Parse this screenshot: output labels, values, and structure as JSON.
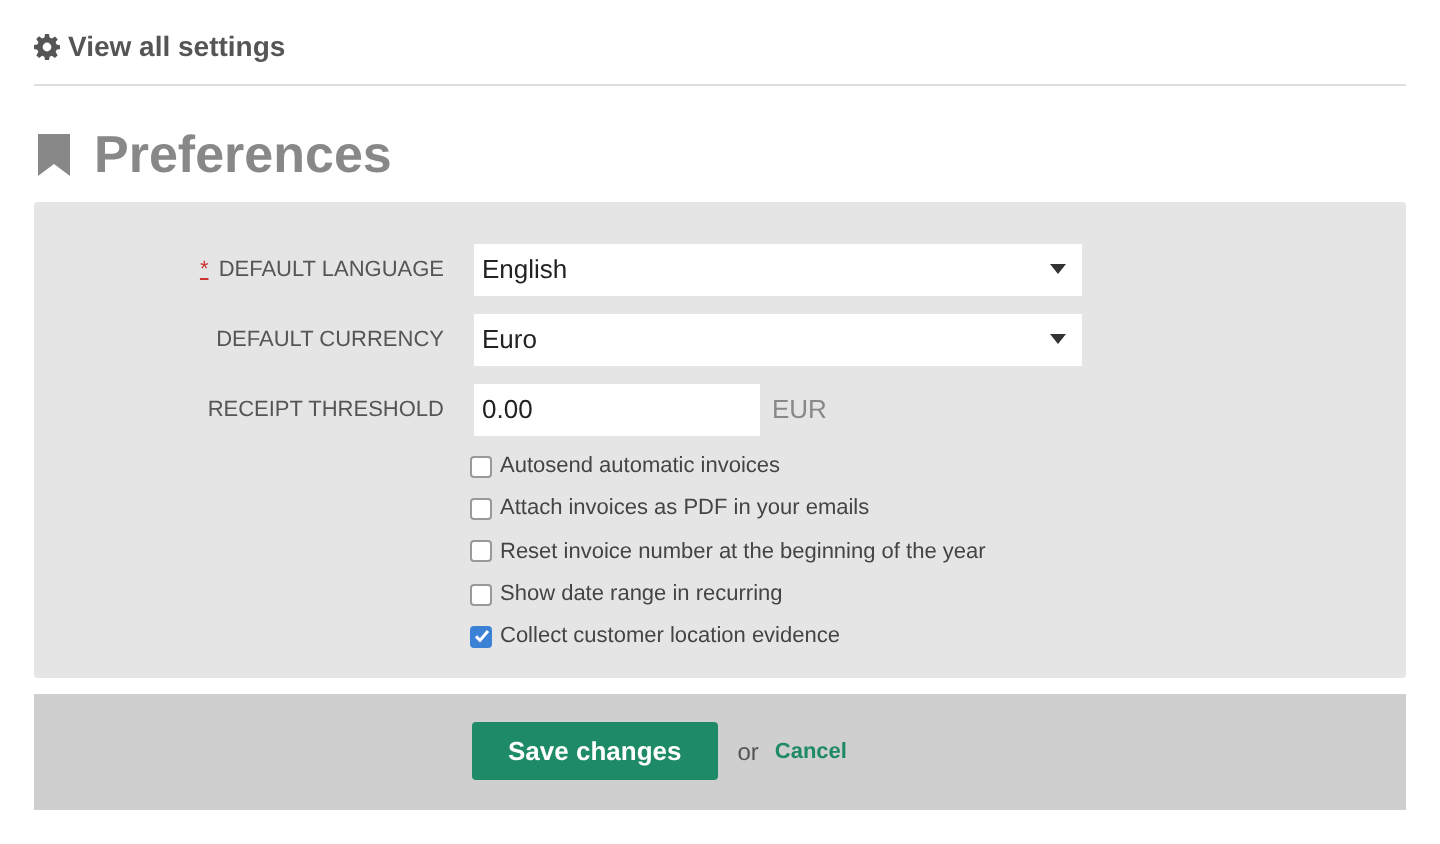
{
  "back_link": {
    "label": "View all settings"
  },
  "title": "Preferences",
  "fields": [
    {
      "kind": "select",
      "required_mark": "*",
      "label": "DEFAULT LANGUAGE",
      "value": "English"
    },
    {
      "kind": "select",
      "label": "DEFAULT CURRENCY",
      "value": "Euro"
    },
    {
      "kind": "text",
      "label": "RECEIPT THRESHOLD",
      "value": "0.00",
      "suffix": "EUR"
    }
  ],
  "options": [
    {
      "label": "Autosend automatic invoices",
      "checked": false
    },
    {
      "label": "Attach invoices as PDF in your emails",
      "checked": false
    },
    {
      "label": "Reset invoice number at the beginning of the year",
      "checked": false
    },
    {
      "label": "Show date range in recurring",
      "checked": false
    },
    {
      "label": "Collect customer location evidence",
      "checked": true
    }
  ],
  "actions": {
    "save": "Save changes",
    "separator": "or",
    "cancel": "Cancel"
  }
}
